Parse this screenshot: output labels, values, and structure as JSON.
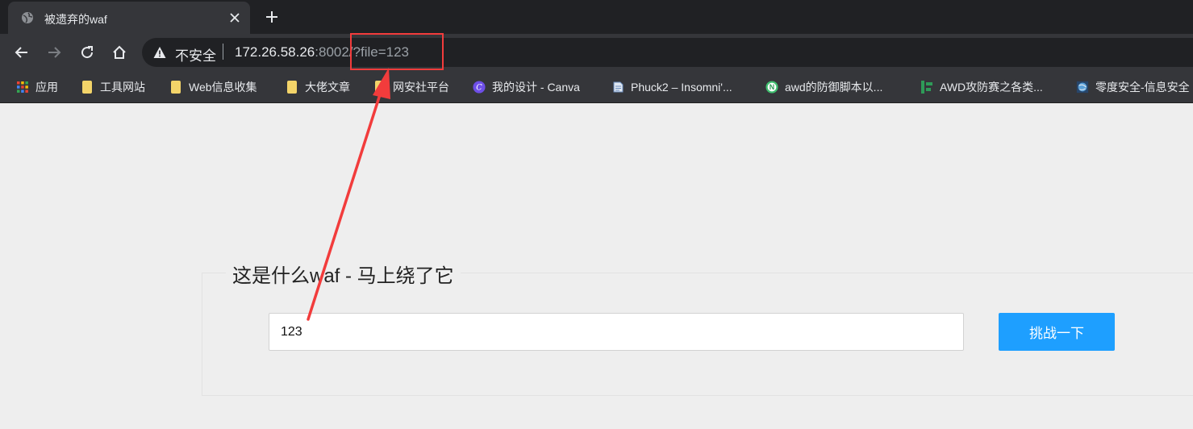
{
  "browser": {
    "tab": {
      "title": "被遗弃的waf"
    },
    "newtab_symbol": "+"
  },
  "toolbar": {
    "security_label": "不安全",
    "url_host": "172.26.58.26",
    "url_rest": ":8002/?file=123"
  },
  "bookmarks": [
    {
      "label": "应用",
      "icon": "apps-grid-icon"
    },
    {
      "label": "工具网站",
      "icon": "folder-icon"
    },
    {
      "label": "Web信息收集",
      "icon": "folder-icon"
    },
    {
      "label": "大佬文章",
      "icon": "folder-icon"
    },
    {
      "label": "网安社平台",
      "icon": "folder-icon"
    },
    {
      "label": "我的设计 - Canva",
      "icon": "canva-icon"
    },
    {
      "label": "Phuck2 – Insomni'...",
      "icon": "document-icon"
    },
    {
      "label": "awd的防御脚本以...",
      "icon": "n-circle-icon"
    },
    {
      "label": "AWD攻防赛之各类...",
      "icon": "green-logo-icon"
    },
    {
      "label": "零度安全-信息安全",
      "icon": "globe-icon"
    }
  ],
  "page": {
    "legend": "这是什么waf - 马上绕了它",
    "input_value": "123",
    "button_label": "挑战一下"
  },
  "colors": {
    "accent": "#1e9fff",
    "annotation": "#f23c3c",
    "folder": "#f3d469"
  }
}
